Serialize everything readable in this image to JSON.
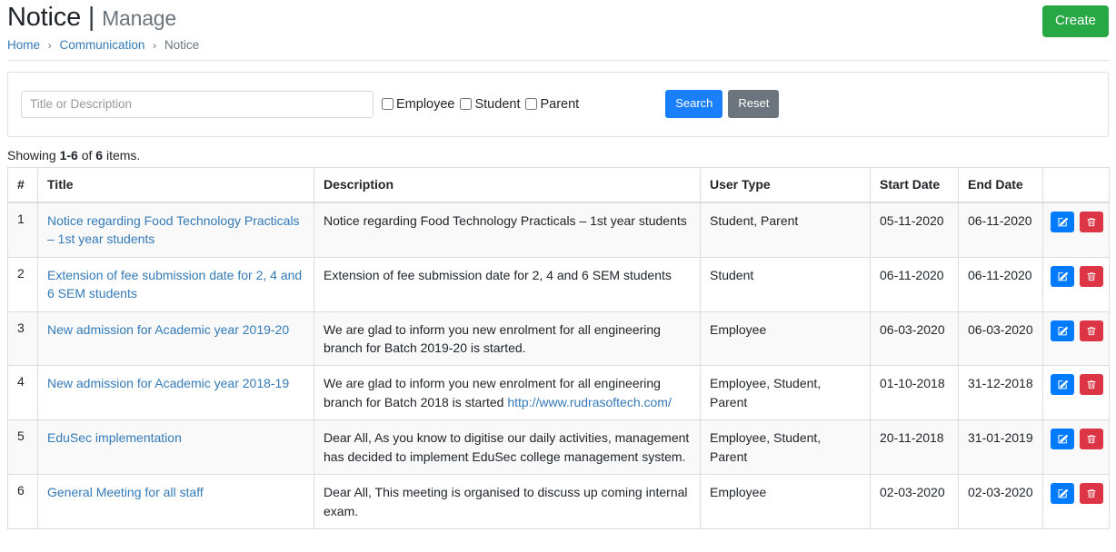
{
  "header": {
    "title": "Notice",
    "separator": "|",
    "subtitle": "Manage",
    "create_label": "Create"
  },
  "breadcrumb": {
    "items": [
      {
        "label": "Home",
        "link": true
      },
      {
        "label": "Communication",
        "link": true
      },
      {
        "label": "Notice",
        "link": false
      }
    ],
    "divider": "›"
  },
  "search": {
    "placeholder": "Title or Description",
    "value": "",
    "checkboxes": [
      {
        "label": "Employee",
        "checked": false
      },
      {
        "label": "Student",
        "checked": false
      },
      {
        "label": "Parent",
        "checked": false
      }
    ],
    "search_label": "Search",
    "reset_label": "Reset"
  },
  "summary": {
    "prefix": "Showing ",
    "range": "1-6",
    "middle": " of ",
    "total": "6",
    "suffix": " items."
  },
  "table": {
    "columns": [
      "#",
      "Title",
      "Description",
      "User Type",
      "Start Date",
      "End Date",
      ""
    ],
    "rows": [
      {
        "num": "1",
        "title": "Notice regarding Food Technology Practicals – 1st year students",
        "description": "Notice regarding Food Technology Practicals – 1st year students",
        "description_link": "",
        "user_type": "Student, Parent",
        "start_date": "05-11-2020",
        "end_date": "06-11-2020"
      },
      {
        "num": "2",
        "title": "Extension of fee submission date for 2, 4 and 6 SEM students",
        "description": "Extension of fee submission date for 2, 4 and 6 SEM students",
        "description_link": "",
        "user_type": "Student",
        "start_date": "06-11-2020",
        "end_date": "06-11-2020"
      },
      {
        "num": "3",
        "title": "New admission for Academic year 2019-20",
        "description": "We are glad to inform you new enrolment for all engineering branch for Batch 2019-20 is started.",
        "description_link": "",
        "user_type": "Employee",
        "start_date": "06-03-2020",
        "end_date": "06-03-2020"
      },
      {
        "num": "4",
        "title": "New admission for Academic year 2018-19",
        "description": "We are glad to inform you new enrolment for all engineering branch for Batch 2018 is started ",
        "description_link": "http://www.rudrasoftech.com/",
        "user_type": "Employee, Student, Parent",
        "start_date": "01-10-2018",
        "end_date": "31-12-2018"
      },
      {
        "num": "5",
        "title": "EduSec implementation",
        "description": "Dear All, As you know to digitise our daily activities, management has decided to implement EduSec college management system.",
        "description_link": "",
        "user_type": "Employee, Student, Parent",
        "start_date": "20-11-2018",
        "end_date": "31-01-2019"
      },
      {
        "num": "6",
        "title": "General Meeting for all staff",
        "description": "Dear All, This meeting is organised to discuss up coming internal exam.",
        "description_link": "",
        "user_type": "Employee",
        "start_date": "02-03-2020",
        "end_date": "02-03-2020"
      }
    ],
    "actions": {
      "edit_icon": "edit-pencil-square-icon",
      "delete_icon": "trash-icon"
    }
  },
  "colors": {
    "create_green": "#28a745",
    "search_blue": "#1a7ffa",
    "reset_gray": "#6c757d",
    "edit_blue": "#007bff",
    "delete_red": "#dc3545",
    "link_blue": "#337ab7"
  }
}
